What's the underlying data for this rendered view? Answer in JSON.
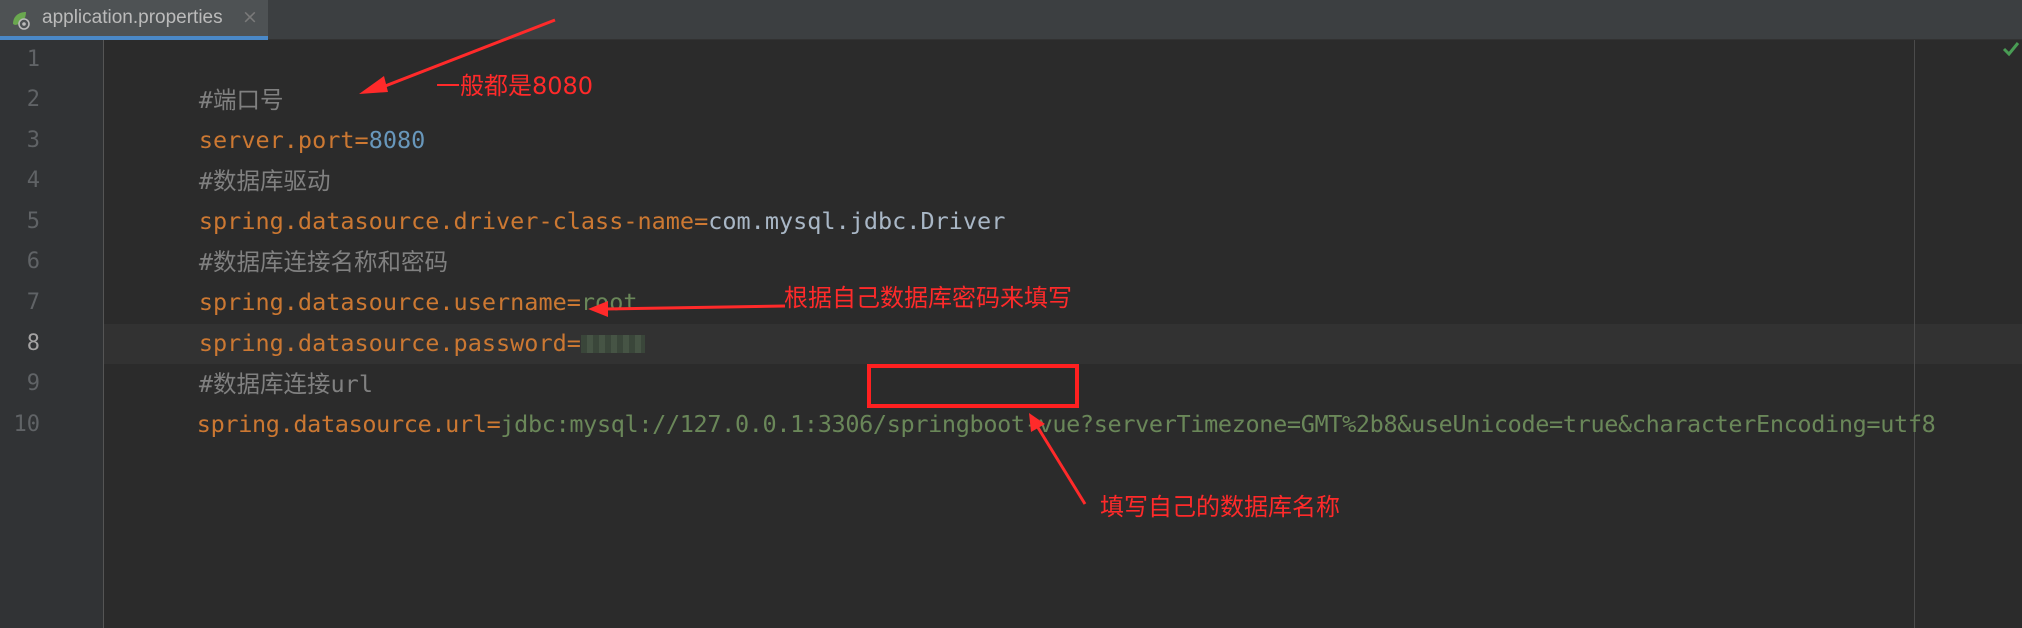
{
  "tab": {
    "title": "application.properties",
    "close_glyph": "×",
    "icon": "spring-properties-icon"
  },
  "line_numbers": [
    "1",
    "2",
    "3",
    "4",
    "5",
    "6",
    "7",
    "8",
    "9",
    "10"
  ],
  "code": {
    "l1": {
      "comment": "#端口号"
    },
    "l2": {
      "key": "server.port",
      "eq": "=",
      "value": "8080"
    },
    "l3": {
      "comment": "#数据库驱动"
    },
    "l4": {
      "key": "spring.datasource.driver-class-name",
      "eq": "=",
      "value": "com.mysql.jdbc.Driver"
    },
    "l5": {
      "comment": "#数据库连接名称和密码"
    },
    "l6": {
      "key": "spring.datasource.username",
      "eq": "=",
      "value": "root"
    },
    "l7": {
      "key": "spring.datasource.password",
      "eq": "="
    },
    "l8": {
      "comment": "#数据库连接url"
    },
    "l9": {
      "key": "spring.datasource.url",
      "eq": "=",
      "value_prefix": "jdbc:mysql://127.0.0.1:3306/",
      "value_db": "springboot-vue",
      "value_suffix": "?serverTimezone=GMT%2b8&useUnicode=true&characterEncoding=utf8"
    }
  },
  "annotations": {
    "port_note": "一般都是8080",
    "password_note": "根据自己数据库密码来填写",
    "dbname_note": "填写自己的数据库名称"
  },
  "colors": {
    "annotation": "#ff2a2a",
    "key": "#cc7832",
    "value": "#6a8759",
    "number": "#6897bb",
    "comment": "#808080"
  }
}
